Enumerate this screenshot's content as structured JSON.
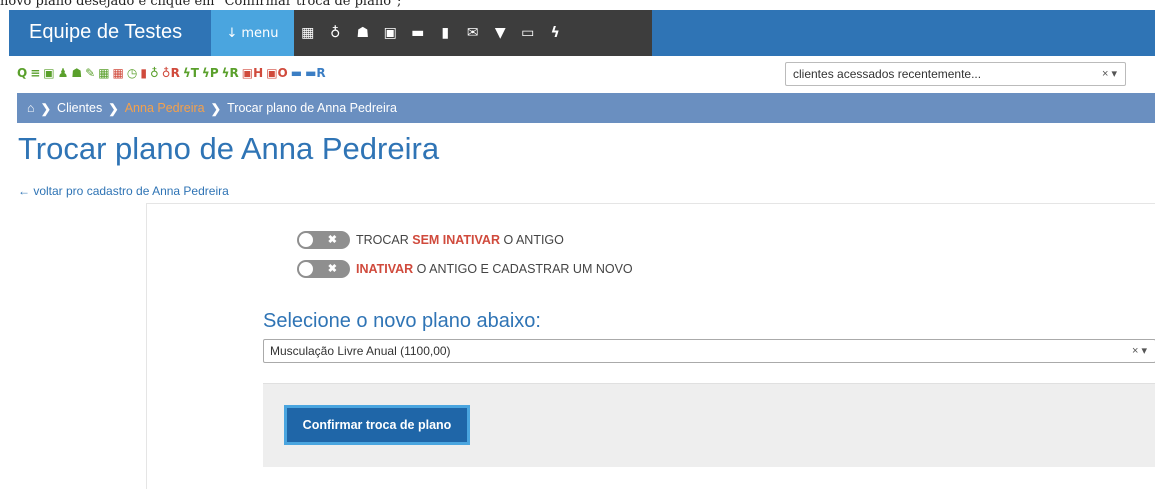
{
  "caption": "novo plano desejado e clique em \"Confirmar troca de plano\";",
  "header": {
    "brand": "Equipe de Testes",
    "menu_label": "menu",
    "menu_icon": "↓",
    "icons": [
      "calendar-icon",
      "stethoscope-icon",
      "users-icon",
      "money-icon",
      "cart-icon",
      "file-icon",
      "envelope-icon",
      "filter-icon",
      "keyboard-icon",
      "bolt-icon"
    ]
  },
  "toolbar": {
    "items": [
      {
        "text": "Q",
        "icon": "search-icon",
        "color": "green"
      },
      {
        "text": "≡",
        "icon": "list-icon",
        "color": "green"
      },
      {
        "text": "▣",
        "icon": "money-icon",
        "color": "green"
      },
      {
        "text": "♟",
        "icon": "user-icon",
        "color": "green"
      },
      {
        "text": "☗",
        "icon": "users-icon",
        "color": "green"
      },
      {
        "text": "✎",
        "icon": "pencil-icon",
        "color": "green"
      },
      {
        "text": "▦",
        "icon": "calendar-icon",
        "color": "green"
      },
      {
        "text": "▦",
        "icon": "calendar-red-icon",
        "color": "red"
      },
      {
        "text": "◷",
        "icon": "clock-icon",
        "color": "green"
      },
      {
        "text": "▮",
        "icon": "bookmark-icon",
        "color": "red"
      },
      {
        "text": "♁",
        "icon": "stethoscope-icon",
        "color": "green"
      },
      {
        "text": "♁R",
        "icon": "stethoscope-r-icon",
        "color": "red"
      },
      {
        "text": "ϟT",
        "icon": "bolt-t-icon",
        "color": "green"
      },
      {
        "text": "ϟP",
        "icon": "bolt-p-icon",
        "color": "green"
      },
      {
        "text": "ϟR",
        "icon": "bolt-r-icon",
        "color": "green"
      },
      {
        "text": "▣H",
        "icon": "money-h-icon",
        "color": "red"
      },
      {
        "text": "▣O",
        "icon": "money-o-icon",
        "color": "red"
      },
      {
        "text": "▬",
        "icon": "cart-icon",
        "color": "blue"
      },
      {
        "text": "▬R",
        "icon": "cart-r-icon",
        "color": "blue"
      }
    ]
  },
  "recent": {
    "value": "clientes acessados recentemente...",
    "clear": "×",
    "arrow": "▾"
  },
  "breadcrumb": {
    "home_icon": "⌂",
    "sep": "❯",
    "clients": "Clientes",
    "client": "Anna Pedreira",
    "current": "Trocar plano de Anna Pedreira"
  },
  "page": {
    "title": "Trocar plano de Anna Pedreira",
    "back_link": "← voltar pro cadastro de Anna Pedreira"
  },
  "options": {
    "toggle1": {
      "before": "TROCAR ",
      "highlight": "SEM INATIVAR",
      "after": " O ANTIGO"
    },
    "toggle2": {
      "before": "",
      "highlight": "INATIVAR",
      "after": " O ANTIGO E CADASTRAR UM NOVO"
    },
    "toggle_x": "✖"
  },
  "plan": {
    "heading": "Selecione o novo plano abaixo:",
    "selected": "Musculação Livre Anual (1100,00)",
    "clear": "×",
    "arrow": "▾"
  },
  "confirm_label": "Confirmar troca de plano",
  "colors": {
    "brand_blue": "#2f74b5",
    "menu_blue": "#4aa5df",
    "dark_bar": "#3d3d3d",
    "breadcrumb_bg": "#6a8fc0",
    "accent_red": "#d04a3c",
    "accent_green": "#5aa02c"
  }
}
